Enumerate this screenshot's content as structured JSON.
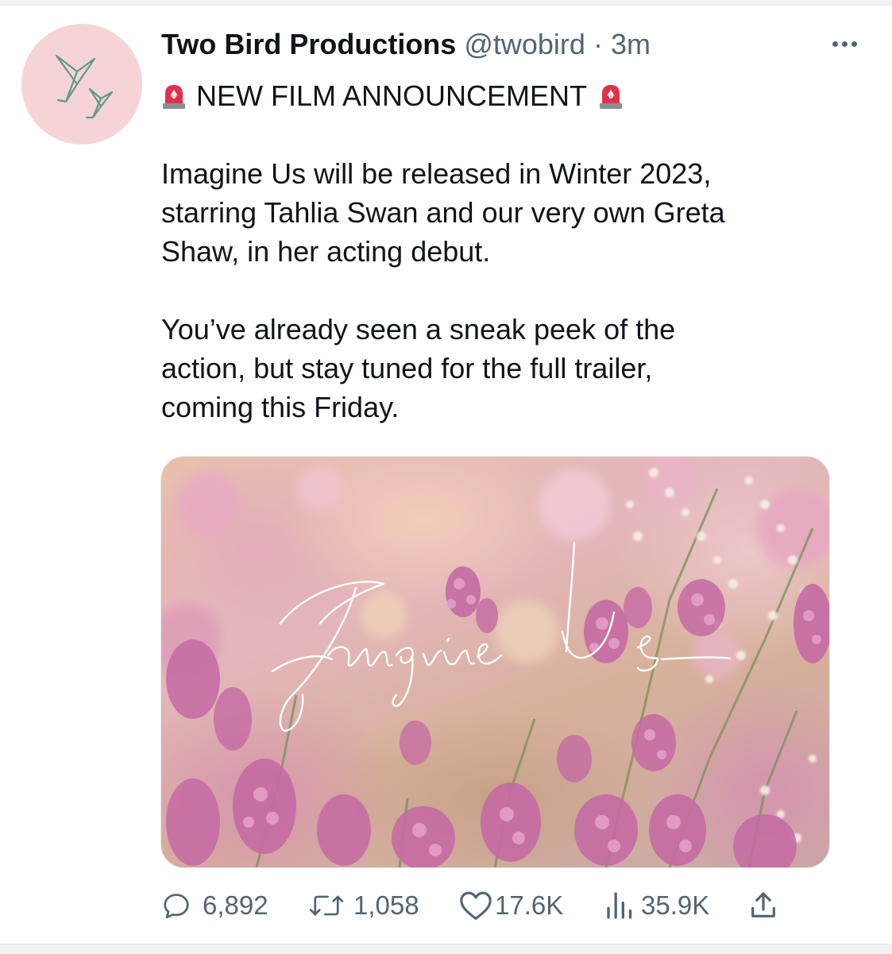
{
  "tweet": {
    "author_name": "Two Bird Productions",
    "handle": "@twobird",
    "separator": "·",
    "timestamp": "3m",
    "headline": "NEW FILM ANNOUNCEMENT",
    "headline_icon": "police-car-light-emoji",
    "paragraph1": [
      "Imagine Us will be released in Winter 2023,",
      "starring Tahlia Swan and our very own Greta",
      "Shaw, in her acting debut."
    ],
    "paragraph2": [
      "You’ve already seen a sneak peek of the",
      "action, but stay tuned for the full trailer,",
      "coming this Friday."
    ],
    "media": {
      "description_icon": "pink-heather-flowers-image",
      "script_title": "Imagine Us"
    },
    "avatar_icon": "origami-birds-logo",
    "more_icon": "more-options-icon"
  },
  "actions": {
    "replies": "6,892",
    "retweets": "1,058",
    "likes": "17.6K",
    "views": "35.9K"
  },
  "colors": {
    "text": "#0f1419",
    "secondary": "#536471",
    "avatar_bg": "#f6d4d6",
    "logo_teal": "#5e9a8e"
  }
}
